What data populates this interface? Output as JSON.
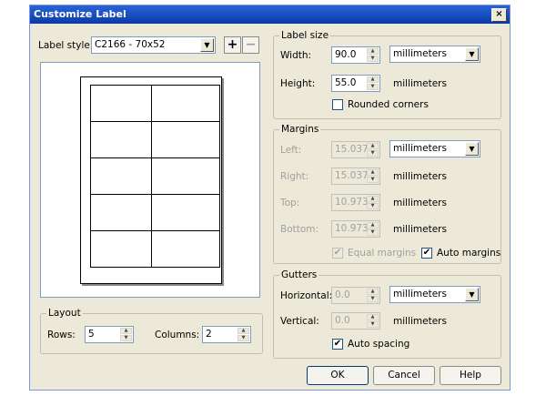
{
  "dialog": {
    "title": "Customize Label",
    "close_glyph": "×"
  },
  "label_style": {
    "label": "Label style:",
    "value": "C2166 - 70x52",
    "add_glyph": "+",
    "remove_glyph": "−"
  },
  "label_size": {
    "title": "Label size",
    "width_label": "Width:",
    "width_value": "90.0",
    "width_unit": "millimeters",
    "height_label": "Height:",
    "height_value": "55.0",
    "height_unit": "millimeters",
    "rounded_label": "Rounded corners",
    "rounded_checked": false
  },
  "margins": {
    "title": "Margins",
    "left_label": "Left:",
    "left_value": "15.037",
    "left_unit": "millimeters",
    "right_label": "Right:",
    "right_value": "15.037",
    "right_unit": "millimeters",
    "top_label": "Top:",
    "top_value": "10.973",
    "top_unit": "millimeters",
    "bottom_label": "Bottom:",
    "bottom_value": "10.973",
    "bottom_unit": "millimeters",
    "equal_label": "Equal margins",
    "equal_checked": true,
    "auto_label": "Auto margins",
    "auto_checked": true
  },
  "gutters": {
    "title": "Gutters",
    "horizontal_label": "Horizontal:",
    "horizontal_value": "0.0",
    "horizontal_unit": "millimeters",
    "vertical_label": "Vertical:",
    "vertical_value": "0.0",
    "vertical_unit": "millimeters",
    "auto_spacing_label": "Auto spacing",
    "auto_spacing_checked": true
  },
  "layout": {
    "title": "Layout",
    "rows_label": "Rows:",
    "rows_value": "5",
    "columns_label": "Columns:",
    "columns_value": "2"
  },
  "buttons": {
    "ok": "OK",
    "cancel": "Cancel",
    "help": "Help"
  },
  "icons": {
    "check": "✔",
    "spin_up": "▲",
    "spin_down": "▼",
    "dropdown": "▼"
  }
}
